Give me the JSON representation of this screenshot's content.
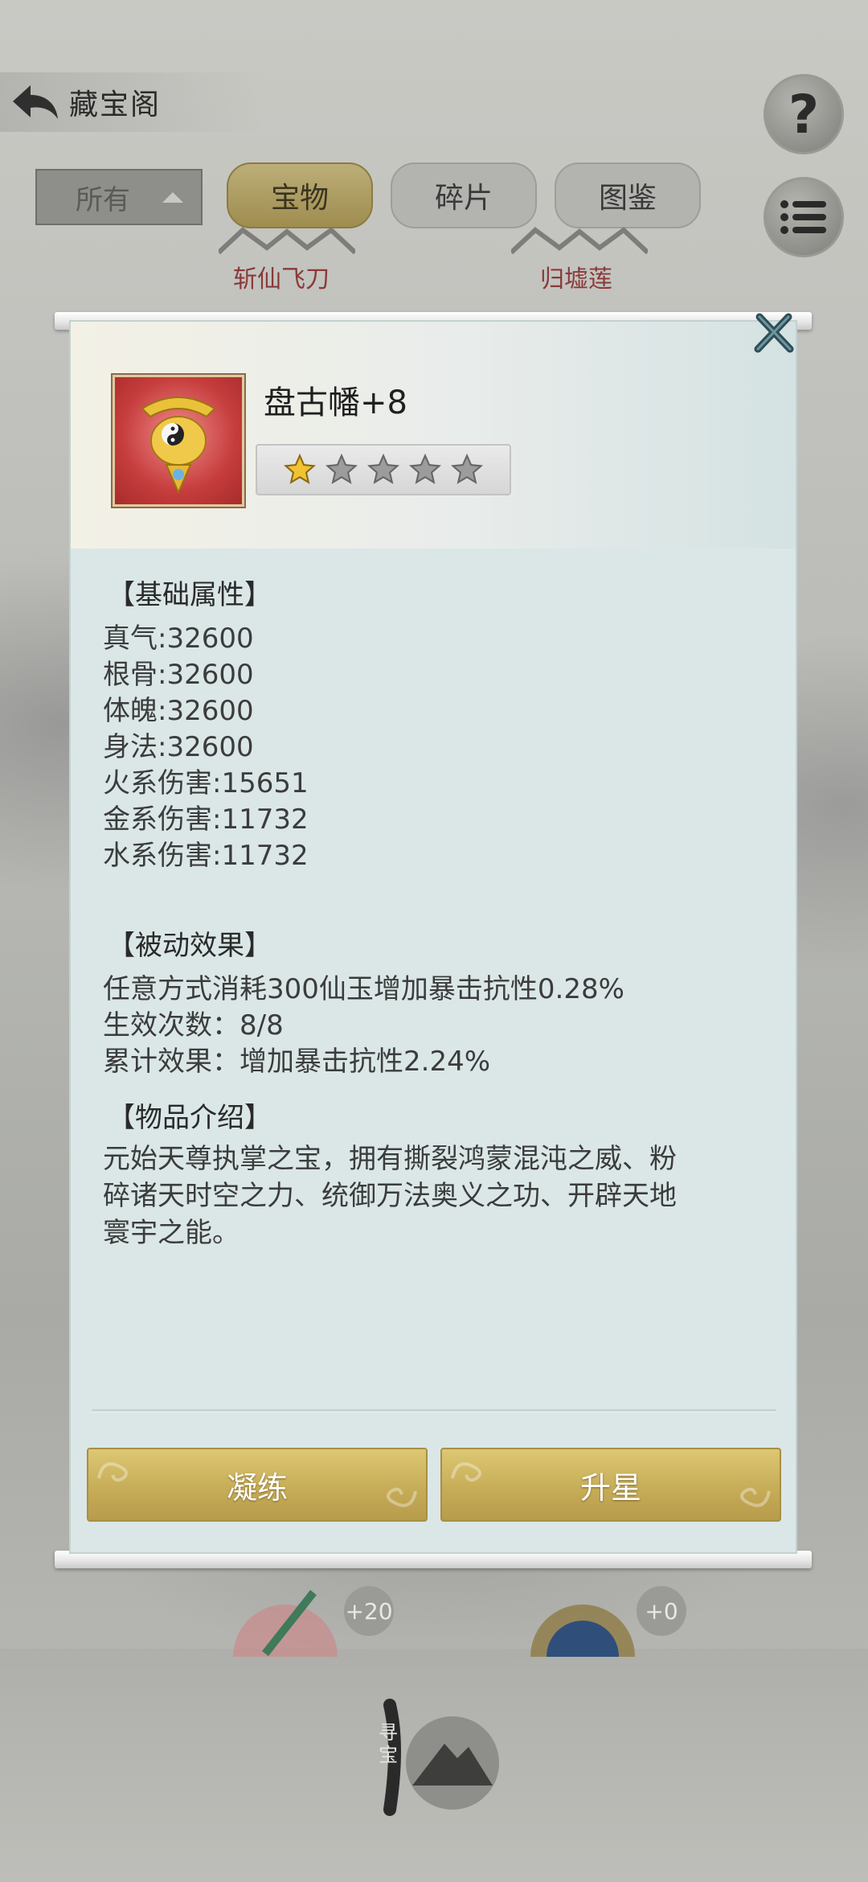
{
  "header": {
    "title": "藏宝阁",
    "help_label": "?",
    "filter": {
      "value": "所有"
    },
    "tabs": [
      {
        "label": "宝物",
        "active": true
      },
      {
        "label": "碎片",
        "active": false
      },
      {
        "label": "图鉴",
        "active": false
      }
    ],
    "background_items": [
      "斩仙飞刀",
      "归墟莲"
    ]
  },
  "detail": {
    "name": "盘古幡+8",
    "stars": {
      "filled": 1,
      "total": 5
    },
    "basic_title": "【基础属性】",
    "attributes": [
      "真气:32600",
      "根骨:32600",
      "体魄:32600",
      "身法:32600",
      "火系伤害:15651",
      "金系伤害:11732",
      "水系伤害:11732"
    ],
    "passive_title": "【被动效果】",
    "passive_lines": [
      "任意方式消耗300仙玉增加暴击抗性0.28%",
      "生效次数：8/8",
      "累计效果：增加暴击抗性2.24%"
    ],
    "intro_title": "【物品介绍】",
    "intro_lines": [
      "元始天尊执掌之宝，拥有撕裂鸿蒙混沌之威、粉",
      "碎诸天时空之力、统御万法奥义之功、开辟天地",
      "寰宇之能。"
    ],
    "buttons": {
      "refine": "凝练",
      "star_up": "升星"
    }
  },
  "bottom": {
    "badges": [
      "+20",
      "+0"
    ],
    "seek_label": "寻宝"
  },
  "colors": {
    "panel_bg": "#dbe7e7",
    "gold_button": "#c7ad58",
    "item_label_red": "#8a3a3a"
  },
  "icons": [
    "back-arrow-icon",
    "help-icon",
    "list-menu-icon",
    "close-icon",
    "star-icon",
    "treasure-banner-icon"
  ]
}
